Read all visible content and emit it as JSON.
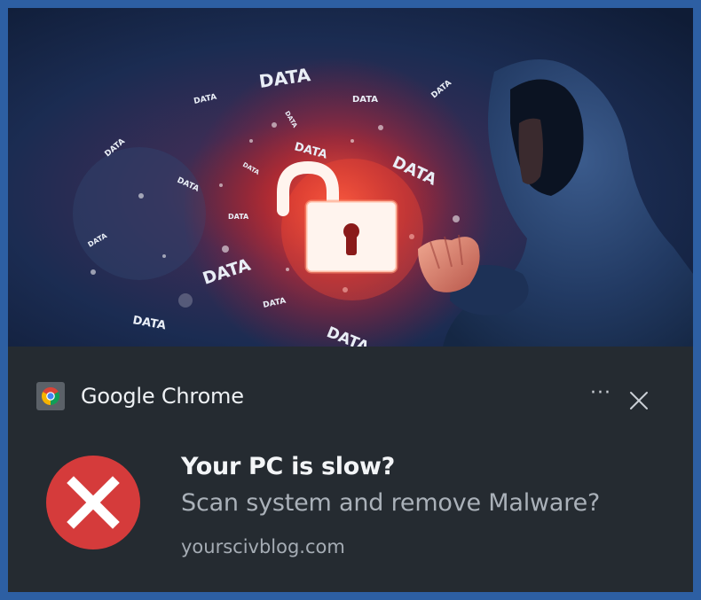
{
  "notification": {
    "app_name": "Google Chrome",
    "title": "Your PC is slow?",
    "message": "Scan system and remove Malware?",
    "source": "yourscivblog.com",
    "more_label": "···"
  },
  "hero": {
    "words": [
      "DATA",
      "DATA",
      "DATA",
      "DATA",
      "DATA",
      "DATA",
      "DATA",
      "DATA",
      "DATA",
      "DATA",
      "DATA",
      "DATA",
      "DATA",
      "DATA",
      "DATA",
      "DATA"
    ]
  },
  "icons": {
    "app": "chrome-icon",
    "more": "more-options-icon",
    "close": "close-icon",
    "error": "error-x-icon"
  },
  "colors": {
    "frame_border": "#2d5fa3",
    "toast_background": "#252b31",
    "error_red": "#d53b3b",
    "lock_glow": "#ff3b2b"
  }
}
